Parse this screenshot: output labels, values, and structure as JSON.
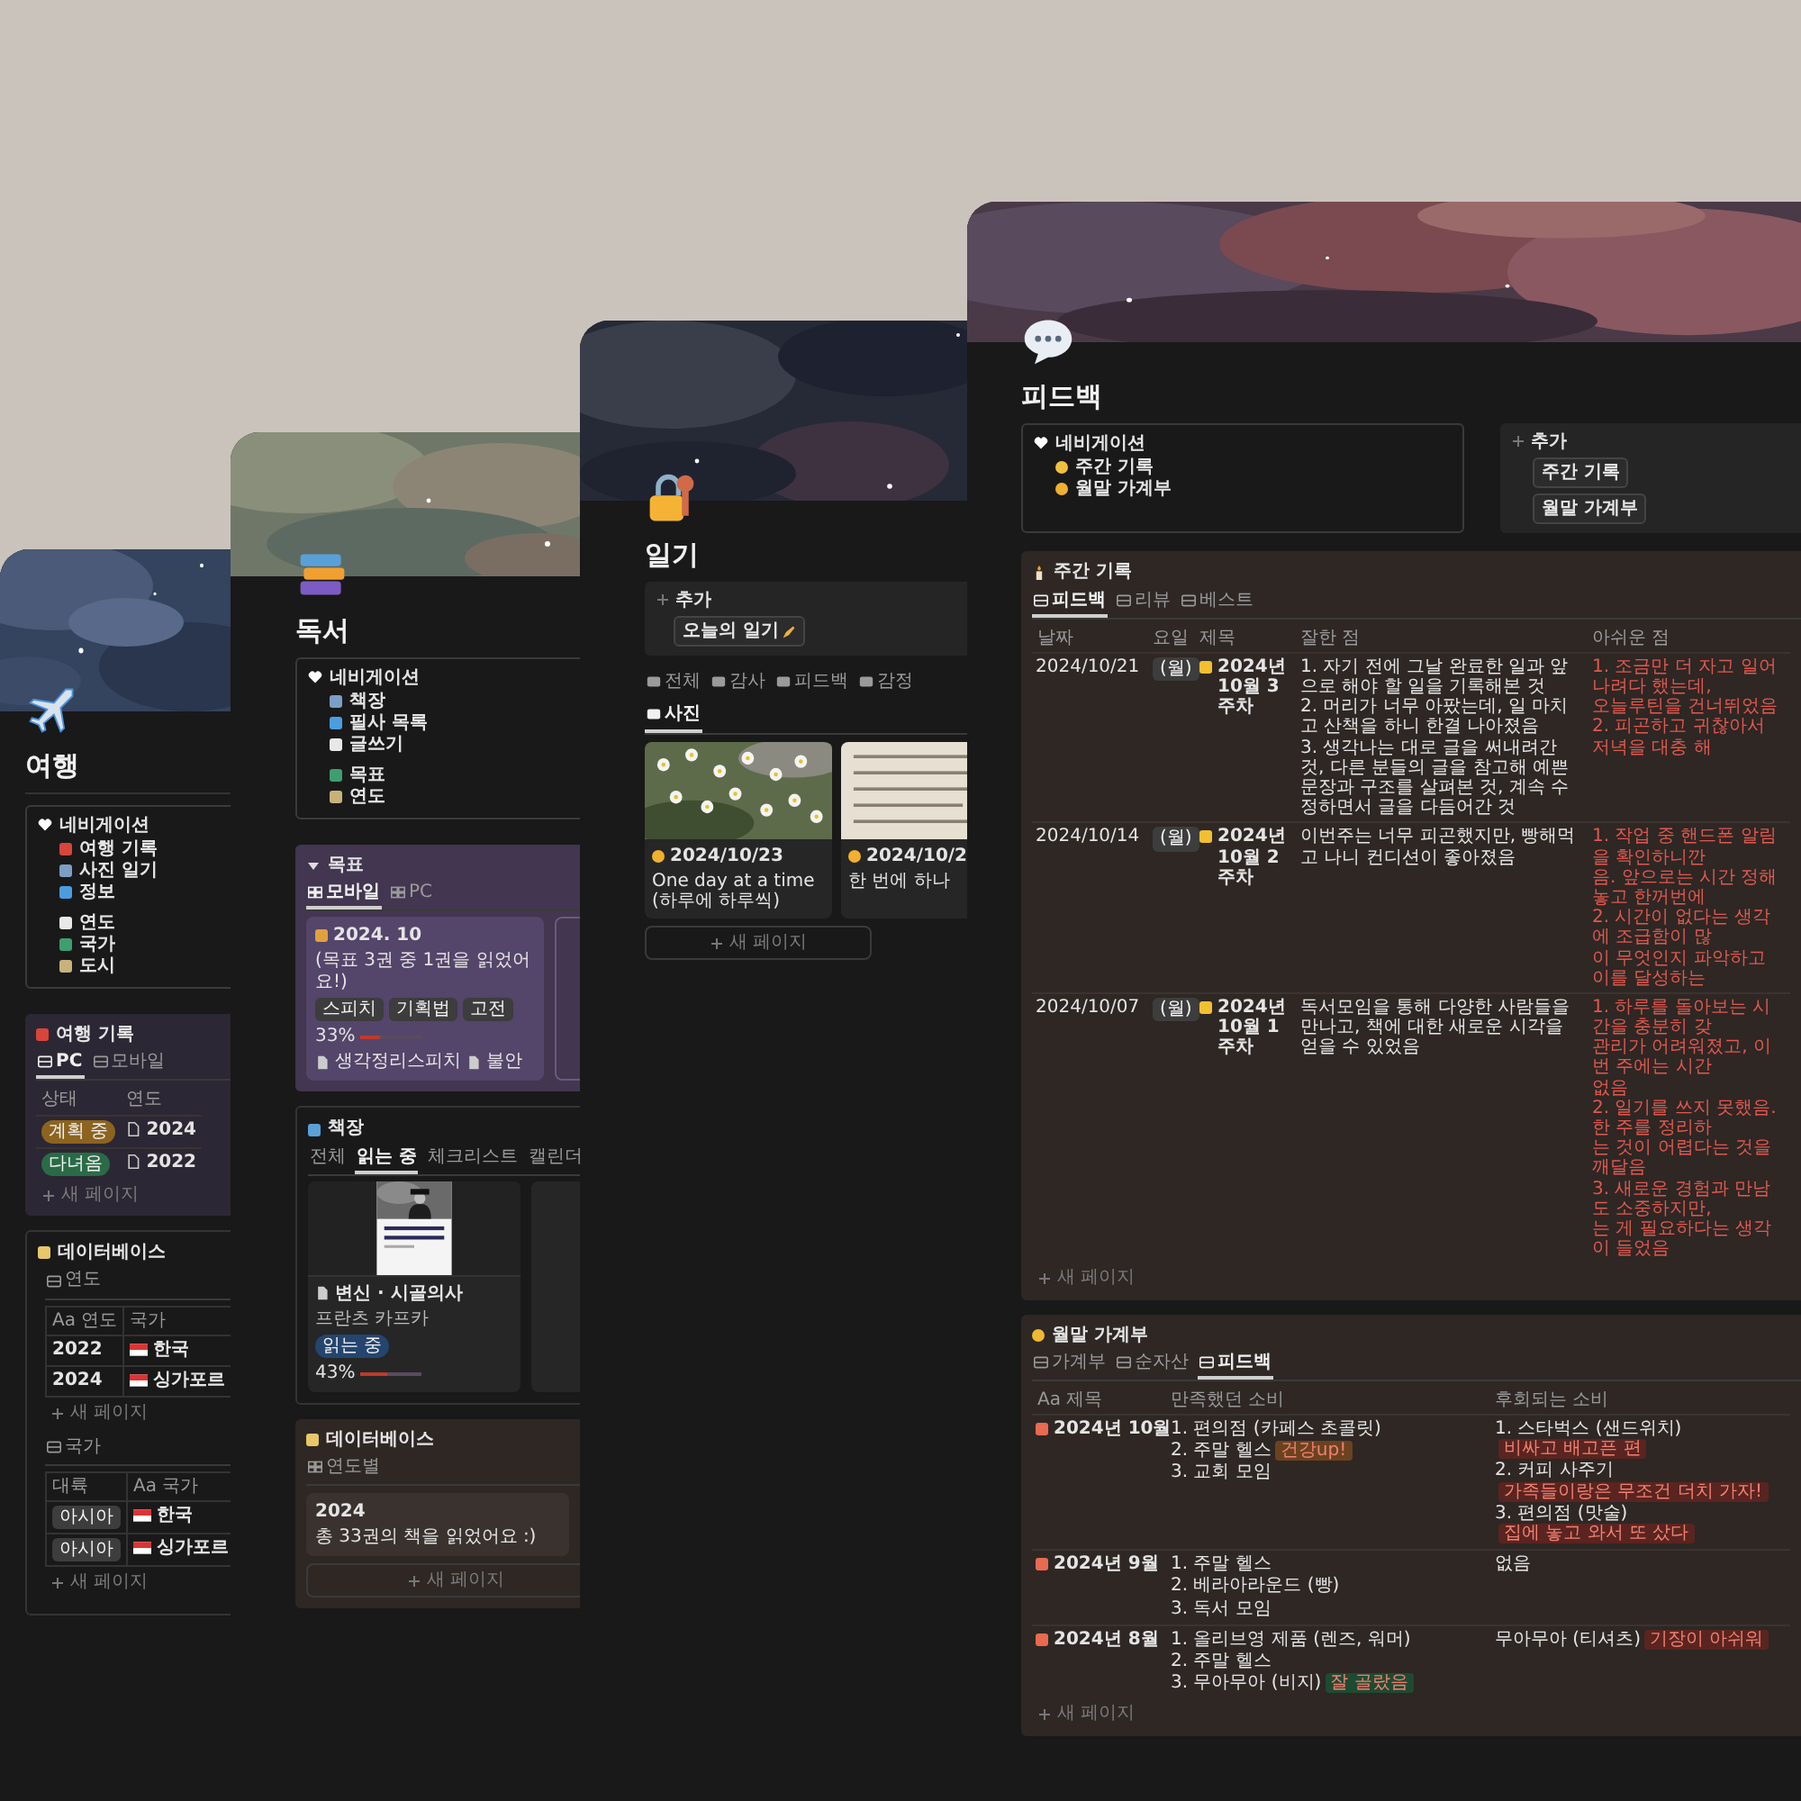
{
  "travel": {
    "title": "여행",
    "nav": {
      "heading": "네비게이션",
      "groups": [
        [
          "여행 기록",
          "사진 일기",
          "정보"
        ],
        [
          "연도",
          "국가",
          "도시"
        ]
      ]
    },
    "records": {
      "title": "여행 기록",
      "views": [
        {
          "label": "PC",
          "selected": true
        },
        {
          "label": "모바일",
          "selected": false
        }
      ],
      "columns": [
        {
          "label": "상태",
          "kind": "status"
        },
        {
          "label": "연도",
          "kind": "page"
        }
      ],
      "rows": [
        {
          "color": "#8c6420",
          "cells": [
            "계획 중",
            "2024"
          ]
        },
        {
          "color": "#2a6b47",
          "cells": [
            "다녀옴",
            "2022"
          ]
        }
      ],
      "new_page": "새 페이지"
    },
    "database": {
      "title": "데이터베이스",
      "tables": [
        {
          "view": "연도",
          "columns": [
            {
              "label": "Aa 연도",
              "kind": "title"
            },
            {
              "label": "국가",
              "kind": "flag"
            }
          ],
          "rows": [
            {
              "cells": [
                "2022",
                "한국"
              ]
            },
            {
              "cells": [
                "2024",
                "싱가포르"
              ]
            }
          ],
          "new_page": "새 페이지"
        },
        {
          "view": "국가",
          "columns": [
            {
              "label": "대륙",
              "kind": "select"
            },
            {
              "label": "Aa 국가",
              "kind": "flag"
            }
          ],
          "rows": [
            {
              "cells": [
                "아시아",
                "한국"
              ]
            },
            {
              "cells": [
                "아시아",
                "싱가포르"
              ]
            }
          ],
          "new_page": "새 페이지"
        }
      ]
    }
  },
  "reading": {
    "title": "독서",
    "nav": {
      "heading": "네비게이션",
      "groups": [
        [
          "책장",
          "필사 목록",
          "글쓰기"
        ],
        [
          "목표",
          "연도"
        ]
      ]
    },
    "goal": {
      "title": "목표",
      "expanded": true,
      "views": [
        {
          "label": "모바일",
          "selected": true
        },
        {
          "label": "PC",
          "selected": false
        }
      ],
      "card": {
        "date": "2024. 10",
        "note": "(목표 3권 중 1권을 읽었어요!)",
        "tags": [
          "스피치",
          "기획법",
          "고전"
        ],
        "percent": "33%",
        "level": 0.33,
        "links": [
          "생각정리스피치",
          "불안"
        ]
      }
    },
    "shelf": {
      "title": "책장",
      "views": [
        {
          "label": "전체",
          "selected": false
        },
        {
          "label": "읽는 중",
          "selected": true
        },
        {
          "label": "체크리스트",
          "selected": false
        },
        {
          "label": "캘린더",
          "selected": false
        }
      ],
      "book": {
        "title": "변신 · 시골의사",
        "author": "프란츠 카프카",
        "status": "읽는 중",
        "percent": "43%",
        "level": 0.43
      }
    },
    "database": {
      "title": "데이터베이스",
      "view": "연도별",
      "group": "2024",
      "summary": "총 33권의 책을 읽었어요 :)",
      "new_page": "새 페이지"
    }
  },
  "diary": {
    "title": "일기",
    "add": {
      "heading": "추가",
      "buttons": [
        "오늘의 일기"
      ]
    },
    "views": [
      {
        "label": "전체",
        "selected": false
      },
      {
        "label": "감사",
        "selected": false
      },
      {
        "label": "피드백",
        "selected": false
      },
      {
        "label": "감정",
        "selected": false
      },
      {
        "label": "사진",
        "selected": true
      }
    ],
    "entries": [
      {
        "date": "2024/10/23",
        "text": "One day at a time (하루에 하루씩)"
      },
      {
        "date": "2024/10/2",
        "text": "한 번에 하나"
      }
    ],
    "new_page": "새 페이지"
  },
  "feedback": {
    "title": "피드백",
    "nav": {
      "heading": "네비게이션",
      "groups": [
        [
          "주간 기록",
          "월말 가계부"
        ]
      ]
    },
    "add": {
      "heading": "추가",
      "buttons": [
        "주간 기록",
        "월말 가계부"
      ]
    },
    "weekly": {
      "title": "주간 기록",
      "views": [
        {
          "label": "피드백",
          "selected": true
        },
        {
          "label": "리뷰",
          "selected": false
        },
        {
          "label": "베스트",
          "selected": false
        }
      ],
      "columns": [
        "날짜",
        "요일",
        "제목",
        "잘한 점",
        "아쉬운 점"
      ],
      "rows": [
        {
          "date": "2024/10/21",
          "day": "(월)",
          "title": "2024년 10월 3주차",
          "good": "1. 자기 전에 그날 완료한 일과 앞으로 해야 할 일을 기록해본 것\n2. 머리가 너무 아팠는데, 일 마치고 산책을 하니 한결 나아졌음\n3. 생각나는 대로 글을 써내려간 것, 다른 분들의 글을 참고해 예쁜 문장과 구조를 살펴본 것, 계속 수정하면서 글을 다듬어간 것",
          "bad": "1. 조금만 더 자고 일어나려다 했는데,\n오늘루틴을 건너뛰었음\n2. 피곤하고 귀찮아서 저녁을 대충 해"
        },
        {
          "date": "2024/10/14",
          "day": "(월)",
          "title": "2024년 10월 2주차",
          "good": "이번주는 너무 피곤했지만, 빵해먹고 나니 컨디션이 좋아졌음",
          "bad": "1. 작업 중 핸드폰 알림을 확인하니깐\n음. 앞으로는 시간 정해놓고 한꺼번에\n2. 시간이 없다는 생각에 조급함이 많\n이 무엇인지 파악하고 이를 달성하는"
        },
        {
          "date": "2024/10/07",
          "day": "(월)",
          "title": "2024년 10월 1주차",
          "good": "독서모임을 통해 다양한 사람들을 만나고, 책에 대한 새로운 시각을 얻을 수 있었음",
          "bad": "1. 하루를 돌아보는 시간을 충분히 갖\n관리가 어려워졌고, 이번 주에는 시간\n없음\n2. 일기를 쓰지 못했음. 한 주를 정리하\n는 것이 어렵다는 것을 깨달음\n3. 새로운 경험과 만남도 소중하지만,\n는 게 필요하다는 생각이 들었음"
        }
      ],
      "new_page": "새 페이지"
    },
    "monthly": {
      "title": "월말 가계부",
      "views": [
        {
          "label": "가계부",
          "selected": false
        },
        {
          "label": "순자산",
          "selected": false
        },
        {
          "label": "피드백",
          "selected": true
        }
      ],
      "columns": [
        "Aa 제목",
        "만족했던 소비",
        "후회되는 소비"
      ],
      "rows": [
        {
          "title": "2024년 10월",
          "good": [
            {
              "text": "1. 편의점 (카페스 초콜릿)"
            },
            {
              "text": "2. 주말 헬스",
              "tag": "건강up!",
              "color": "#6b4220"
            },
            {
              "text": "3. 교회 모임"
            }
          ],
          "bad": [
            {
              "text": "1. 스타벅스 (샌드위치)",
              "tag": "비싸고 배고픈 편",
              "color": "#5a2420"
            },
            {
              "text": "2. 커피 사주기",
              "tag": "가족들이랑은 무조건 더치 가자!",
              "color": "#5a2420"
            },
            {
              "text": "3. 편의점 (맛술)",
              "tag": "집에 놓고 와서 또 샀다",
              "color": "#5a2420"
            }
          ]
        },
        {
          "title": "2024년 9월",
          "good": [
            {
              "text": "1. 주말 헬스"
            },
            {
              "text": "2. 베라아라운드 (빵)"
            },
            {
              "text": "3. 독서 모임"
            }
          ],
          "bad": [
            {
              "text": "없음"
            }
          ]
        },
        {
          "title": "2024년 8월",
          "good": [
            {
              "text": "1. 올리브영 제품 (렌즈, 워머)"
            },
            {
              "text": "2. 주말 헬스"
            },
            {
              "text": "3. 무아무아 (비지)",
              "tag": "잘 골랐음",
              "color": "#1f4a32"
            }
          ],
          "bad": [
            {
              "text": "무아무아 (티셔츠)",
              "tag": "기장이 아쉬워",
              "color": "#5a2420"
            }
          ]
        }
      ],
      "new_page": "새 페이지"
    }
  }
}
